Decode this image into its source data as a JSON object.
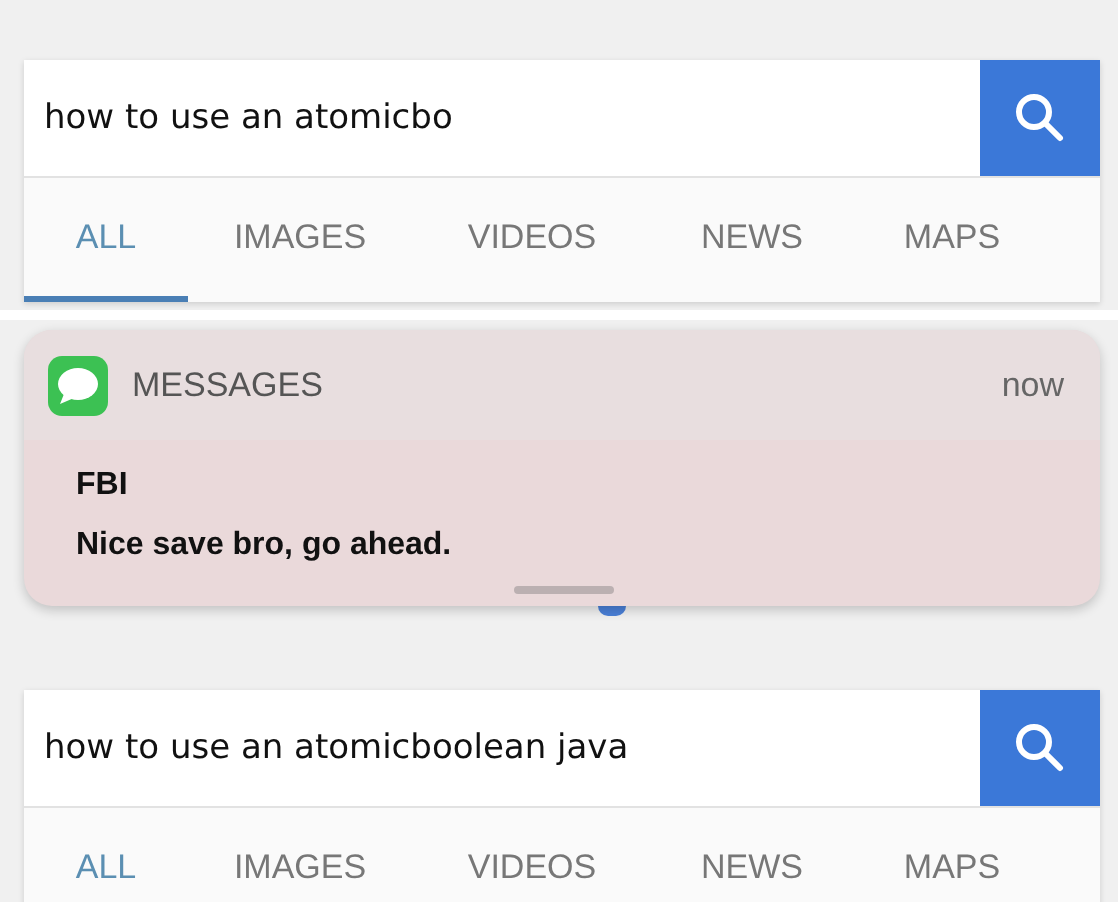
{
  "screens": [
    {
      "query": "how to use an atomicbo",
      "tabs": [
        {
          "label": "ALL",
          "selected": true
        },
        {
          "label": "IMAGES",
          "selected": false
        },
        {
          "label": "VIDEOS",
          "selected": false
        },
        {
          "label": "NEWS",
          "selected": false
        },
        {
          "label": "MAPS",
          "selected": false
        }
      ]
    },
    {
      "query": "how to use an atomicboolean java",
      "tabs": [
        {
          "label": "ALL",
          "selected": true
        },
        {
          "label": "IMAGES",
          "selected": false
        },
        {
          "label": "VIDEOS",
          "selected": false
        },
        {
          "label": "NEWS",
          "selected": false
        },
        {
          "label": "MAPS",
          "selected": false
        }
      ],
      "notification": {
        "app": "MESSAGES",
        "time": "now",
        "sender": "FBI",
        "message": "Nice save bro, go ahead."
      }
    }
  ]
}
